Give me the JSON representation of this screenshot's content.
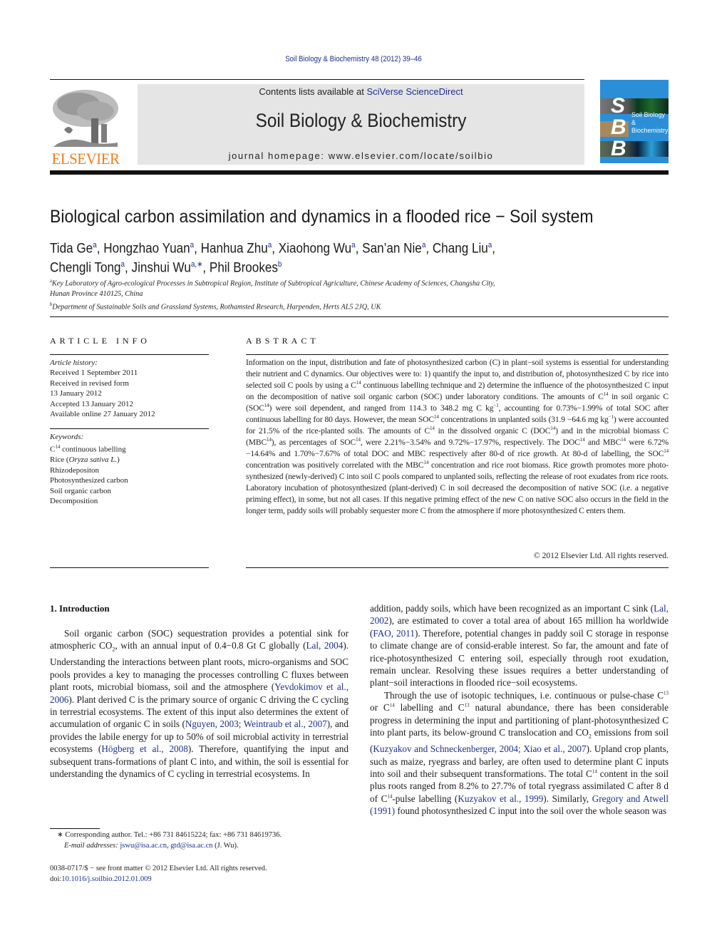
{
  "header": {
    "citation": "Soil Biology & Biochemistry 48 (2012) 39–46",
    "contents_prefix": "Contents lists available at ",
    "contents_link": "SciVerse ScienceDirect",
    "journal_title": "Soil Biology & Biochemistry",
    "homepage": "journal homepage: www.elsevier.com/locate/soilbio",
    "publisher_logo_text": "ELSEVIER",
    "cover_letters": [
      "S",
      "B",
      "B"
    ],
    "cover_title_line1": "Soil Biology &",
    "cover_title_line2": "Biochemistry"
  },
  "article": {
    "title": "Biological carbon assimilation and dynamics in a flooded rice − Soil system",
    "authors": [
      {
        "name": "Tida Ge",
        "aff": "a"
      },
      {
        "name": "Hongzhao Yuan",
        "aff": "a"
      },
      {
        "name": "Hanhua Zhu",
        "aff": "a"
      },
      {
        "name": "Xiaohong Wu",
        "aff": "a"
      },
      {
        "name": "San’an Nie",
        "aff": "a"
      },
      {
        "name": "Chang Liu",
        "aff": "a"
      },
      {
        "name": "Chengli Tong",
        "aff": "a"
      },
      {
        "name": "Jinshui Wu",
        "aff": "a,∗"
      },
      {
        "name": "Phil Brookes",
        "aff": "b"
      }
    ],
    "affiliations": [
      {
        "mark": "a",
        "line1": "Key Laboratory of Agro-ecological Processes in Subtropical Region, Institute of Subtropical Agriculture, Chinese Academy of Sciences, Changsha City,",
        "line2": "Hunan Province 410125, China"
      },
      {
        "mark": "b",
        "line1": "Department of Sustainable Soils and Grassland Systems, Rothamsted Research, Harpenden, Herts AL5 2JQ, UK"
      }
    ]
  },
  "article_info": {
    "heading": "ARTICLE INFO",
    "history_label": "Article history:",
    "history": [
      "Received 1 September 2011",
      "Received in revised form",
      "13 January 2012",
      "Accepted 13 January 2012",
      "Available online 27 January 2012"
    ],
    "keywords_label": "Keywords:",
    "keywords": {
      "k1_prefix": "C",
      "k1_sup": "14",
      "k1_suffix": " continuous labelling",
      "k2_prefix": "Rice (",
      "k2_italic": "Oryza sativa L.",
      "k2_suffix": ")",
      "k3": "Rhizodepositon",
      "k4": "Photosynthesized carbon",
      "k5": "Soil organic carbon",
      "k6": "Decomposition"
    }
  },
  "abstract": {
    "heading": "ABSTRACT",
    "s1": "Information on the input, distribution and fate of photosynthesized carbon (C) in plant−soil systems is essential for understanding their nutrient and C dynamics. Our objectives were to: 1) quantify the input to, and distribution of, photosynthesized C by rice into selected soil C pools by using a C",
    "s2": " continuous labelling technique and 2) determine the influence of the photosynthesized C input on the decomposition of native soil organic carbon (SOC) under laboratory conditions. The amounts of C",
    "s3": " in soil organic C (SOC",
    "s4": ") were soil dependent, and ranged from 114.3 to 348.2 mg C kg",
    "s5": ", accounting for 0.73%−1.99% of total SOC after continuous labelling for 80 days. However, the mean SOC",
    "s6": " concentrations in unplanted soils (31.9 −64.6 mg kg",
    "s7": ") were accounted for 21.5% of the rice-planted soils. The amounts of C",
    "s8": " in the dissolved organic C (DOC",
    "s9": ") and in the microbial biomass C (MBC",
    "s10": "), as percentages of SOC",
    "s11": ", were 2.21%−3.54% and 9.72%−17.97%, respectively. The DOC",
    "s12": " and MBC",
    "s13": " were 6.72%−14.64% and 1.70%−7.67% of total DOC and MBC respectively after 80-d of rice growth. At 80-d of labelling, the SOC",
    "s14": " concentration was positively correlated with the MBC",
    "s15": " concentration and rice root biomass. Rice growth promotes more photo-synthesized (newly-derived) C into soil C pools compared to unplanted soils, reflecting the release of root exudates from rice roots. Laboratory incubation of photosynthesized (plant-derived) C in soil decreased the decomposition of native SOC (i.e. a negative priming effect), in some, but not all cases. If this negative priming effect of the new C on native SOC also occurs in the field in the longer term, paddy soils will probably sequester more C from the atmosphere if more photosynthesized C enters them.",
    "sup14": "14",
    "supneg1": "−1",
    "copyright": "© 2012 Elsevier Ltd. All rights reserved."
  },
  "introduction": {
    "heading": "1.  Introduction",
    "p1_a": "Soil organic carbon (SOC) sequestration provides a potential sink for atmospheric CO",
    "p1_sub": "2",
    "p1_b": ", with an annual input of 0.4−0.8 Gt C globally (",
    "ref_lal2004": "Lal, 2004",
    "p1_c": "). Understanding the interactions between plant roots, micro-organisms and SOC pools provides a key to managing the processes controlling C fluxes between plant roots, microbial biomass, soil and the atmosphere (",
    "ref_yevdokimov": "Yevdokimov et al., 2006",
    "p1_d": "). Plant derived C is the primary source of organic C driving the C cycling in terrestrial ecosystems. The extent of this input also determines the extent of accumulation of organic C in soils (",
    "ref_nguyen": "Nguyen, 2003; Weintraub et al., 2007",
    "p1_e": "), and provides the labile energy for up to 50% of soil microbial activity in terrestrial ecosystems (",
    "ref_hogberg": "Högberg et al., 2008",
    "p1_f": "). Therefore, quantifying the input and subsequent trans-formations of plant C into, and within, the soil is essential for understanding the dynamics of C cycling in terrestrial ecosystems. In",
    "p1_g": "addition, paddy soils, which have been recognized as an important C sink (",
    "ref_lal2002": "Lal, 2002",
    "p1_h": "), are estimated to cover a total area of about 165 million ha worldwide (",
    "ref_fao": "FAO, 2011",
    "p1_i": "). Therefore, potential changes in paddy soil C storage in response to climate change are of consid-erable interest. So far, the amount and fate of rice-photosynthesized C entering soil, especially through root exudation, remain unclear. Resolving these issues requires a better understanding of plant−soil interactions in flooded rice−soil ecosystems.",
    "p2_a": "Through the use of isotopic techniques, i.e. continuous or pulse-chase C",
    "sup13": "13",
    "p2_b": " or C",
    "sup14": "14",
    "p2_c": " labelling and C",
    "p2_d": " natural abundance, there has been considerable progress in determining the input and partitioning of plant-photosynthesized C into plant parts, its below-ground C translocation and CO",
    "p2_sub": "2",
    "p2_e": " emissions from soil (",
    "ref_kuzyakov2004": "Kuzyakov and Schneckenberger, 2004; Xiao et al., 2007",
    "p2_f": "). Upland crop plants, such as maize, ryegrass and barley, are often used to determine plant C inputs into soil and their subsequent transformations. The total C",
    "p2_g": " content in the soil plus roots ranged from 8.2% to 27.7% of total ryegrass assimilated C after 8 d of C",
    "p2_h": "-pulse labelling (",
    "ref_kuzyakov1999": "Kuzyakov et al., 1999",
    "p2_i": "). Similarly, ",
    "ref_gregory": "Gregory and Atwell (1991)",
    "p2_j": " found photosynthesized C input into the soil over the whole season was"
  },
  "footnotes": {
    "corresponding": "∗  Corresponding author. Tel.: +86 731 84615224; fax: +86 731 84619736.",
    "email_label": "E-mail addresses: ",
    "email1": "jswu@isa.ac.cn",
    "email_sep": ", ",
    "email2": "gtd@isa.ac.cn",
    "email_suffix": " (J. Wu).",
    "issn": "0038-0717/$ − see front matter © 2012 Elsevier Ltd. All rights reserved.",
    "doi_label": "doi:",
    "doi": "10.1016/j.soilbio.2012.01.009"
  },
  "colors": {
    "link": "#1f2f8a",
    "elsevier_orange": "#f07d1a",
    "banner_gray": "#e5e5e5",
    "cover_blue": "#2b8fd8"
  }
}
